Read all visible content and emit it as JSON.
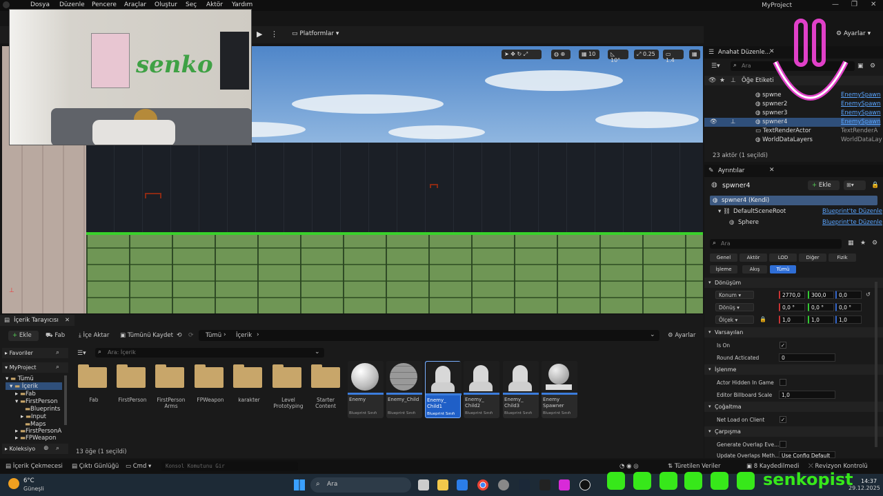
{
  "menu": [
    "Dosya",
    "Düzenle",
    "Pencere",
    "Araçlar",
    "Oluştur",
    "Seç",
    "Aktör",
    "Yardım"
  ],
  "window_title": "MyProject",
  "toolbar": {
    "platforms": "Platformlar",
    "settings": "Ayarlar"
  },
  "viewport_tools": {
    "grid": "10",
    "angle": "10°",
    "scale": "0.25",
    "camera": "1.4"
  },
  "webcam_text": "senko",
  "outliner": {
    "tab": "Anahat Düzenle...",
    "search_placeholder": "Ara",
    "column": "Öğe Etiketi",
    "rows": [
      {
        "name": "spwne",
        "type": "EnemySpawn"
      },
      {
        "name": "spwner2",
        "type": "EnemySpawn"
      },
      {
        "name": "spwner3",
        "type": "EnemySpawn"
      },
      {
        "name": "spwner4",
        "type": "EnemySpawn"
      },
      {
        "name": "TextRenderActor",
        "type": "TextRenderA"
      },
      {
        "name": "WorldDataLayers",
        "type": "WorldDataLay"
      }
    ],
    "count": "23 aktör (1 seçildi)"
  },
  "details": {
    "tab": "Ayrıntılar",
    "actor": "spwner4",
    "add": "Ekle",
    "self": "spwner4 (Kendi)",
    "components": [
      {
        "name": "DefaultSceneRoot",
        "link": "Blueprint'te Düzenle"
      },
      {
        "name": "Sphere",
        "link": "Blueprint'te Düzenle"
      }
    ],
    "search_placeholder": "Ara",
    "filters": [
      "Genel",
      "Aktör",
      "LOD",
      "Diğer",
      "Fizik",
      "İşleme",
      "Akış",
      "Tümü"
    ],
    "transform_title": "Dönüşüm",
    "location": {
      "label": "Konum",
      "x": "2770,0",
      "y": "300,0",
      "z": "0,0"
    },
    "rotation": {
      "label": "Dönüş",
      "x": "0,0 °",
      "y": "0,0 °",
      "z": "0,0 °"
    },
    "scale": {
      "label": "Ölçek",
      "x": "1,0",
      "y": "1,0",
      "z": "1,0"
    },
    "defaults_title": "Varsayılan",
    "is_on": "Is On",
    "round": "Round Acticated",
    "round_val": "0",
    "render_title": "İşlenme",
    "hidden": "Actor Hidden In Game",
    "billboard": "Editor Billboard Scale",
    "billboard_val": "1,0",
    "repl_title": "Çoğaltma",
    "net_load": "Net Load on Client",
    "coll_title": "Çarpışma",
    "overlap": "Generate Overlap Eve...",
    "overlap2": "Update Overlaps Meth...",
    "overlap2_val": "Use Config Default"
  },
  "content_browser": {
    "tab": "İçerik Tarayıcısı",
    "add": "Ekle",
    "fab": "Fab",
    "import": "İçe Aktar",
    "save_all": "Tümünü Kaydet",
    "path": [
      "Tümü",
      "İçerik"
    ],
    "settings": "Ayarlar",
    "favorites": "Favoriler",
    "project": "MyProject",
    "search_placeholder": "Ara: İçerik",
    "tree": [
      "Tümü",
      "İçerik",
      "Fab",
      "FirstPerson",
      "Blueprints",
      "Input",
      "Maps",
      "FirstPersonA",
      "FPWeapon"
    ],
    "collections": "Koleksiyo",
    "folders": [
      "Fab",
      "FirstPerson",
      "FirstPerson Arms",
      "FPWeapon",
      "karakter",
      "Level Prototyping",
      "Starter Content"
    ],
    "assets": [
      {
        "name": "Enemy",
        "type": "Blueprint Sınıfı"
      },
      {
        "name": "Enemy_Child",
        "type": "Blueprint Sınıfı"
      },
      {
        "name": "Enemy_ Child1",
        "type": "Blueprint Sınıfı"
      },
      {
        "name": "Enemy_ Child2",
        "type": "Blueprint Sınıfı"
      },
      {
        "name": "Enemy_ Child3",
        "type": "Blueprint Sınıfı"
      },
      {
        "name": "Enemy Spawner",
        "type": "Blueprint Sınıfı"
      }
    ],
    "count": "13 öğe (1 seçildi)"
  },
  "statusbar": {
    "drawer": "İçerik Çekmecesi",
    "log": "Çıktı Günlüğü",
    "cmd": "Cmd",
    "console_placeholder": "Konsol Komutunu Gir",
    "derived": "Türetilen Veriler",
    "unsaved": "8 Kaydedilmedi",
    "revision": "Revizyon Kontrolü"
  },
  "taskbar": {
    "temp": "6°C",
    "weather": "Güneşli",
    "search": "Ara",
    "time": "14:37",
    "date": "29.12.2025"
  },
  "overlay_brand": "senkopist",
  "colors": {
    "accent": "#3b7ddd",
    "selected_row": "#2f4f7a",
    "social_green": "#37e81a",
    "smile": "#e040c8"
  }
}
